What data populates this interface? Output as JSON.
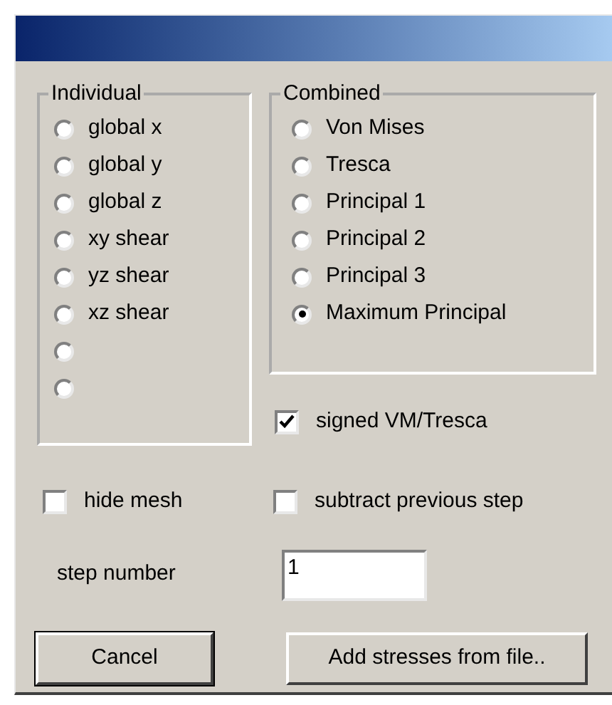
{
  "groups": [
    {
      "title": "Individual",
      "options": [
        {
          "label": "global x",
          "selected": false
        },
        {
          "label": "global y",
          "selected": false
        },
        {
          "label": "global z",
          "selected": false
        },
        {
          "label": "xy shear",
          "selected": false
        },
        {
          "label": "yz shear",
          "selected": false
        },
        {
          "label": "xz shear",
          "selected": false
        },
        {
          "selected": false
        },
        {
          "selected": false
        }
      ]
    },
    {
      "title": "Combined",
      "options": [
        {
          "label": "Von Mises",
          "selected": false
        },
        {
          "label": "Tresca",
          "selected": false
        },
        {
          "label": "Principal 1",
          "selected": false
        },
        {
          "label": "Principal 2",
          "selected": false
        },
        {
          "label": "Principal 3",
          "selected": false
        },
        {
          "label": "Maximum Principal",
          "selected": true
        }
      ]
    }
  ],
  "signed_checkbox": {
    "label": "signed VM/Tresca",
    "checked": true
  },
  "hide_mesh": {
    "label": "hide mesh",
    "checked": false
  },
  "subtract_previous": {
    "label": "subtract previous step",
    "checked": false
  },
  "step_number": {
    "label": "step number",
    "value": "1"
  },
  "buttons": [
    {
      "label": "Cancel",
      "default": true
    },
    {
      "label": "Add stresses from file..",
      "default": false
    }
  ]
}
